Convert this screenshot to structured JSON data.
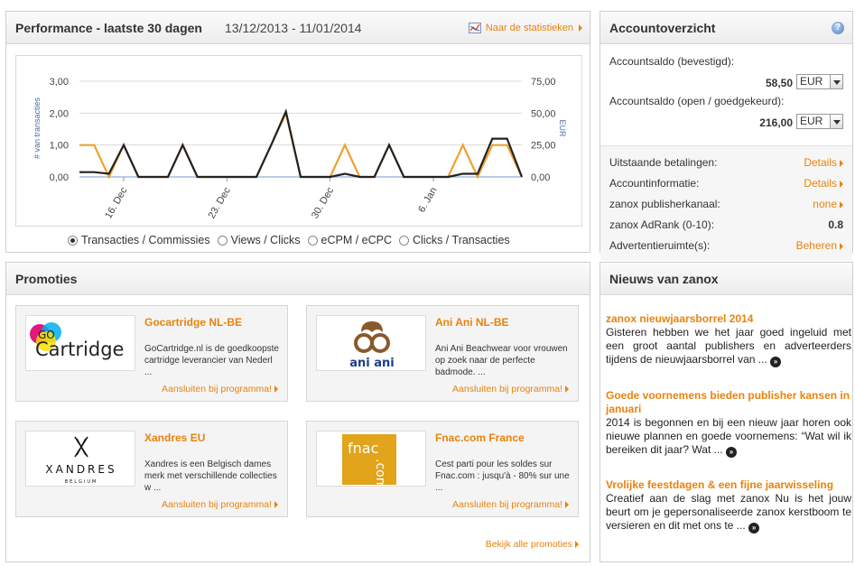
{
  "performance": {
    "title": "Performance - laatste 30 dagen",
    "dates": "13/12/2013 - 11/01/2014",
    "stats_link": "Naar de statistieken",
    "radios": [
      {
        "label": "Transacties / Commissies",
        "checked": true
      },
      {
        "label": "Views / Clicks",
        "checked": false
      },
      {
        "label": "eCPM / eCPC",
        "checked": false
      },
      {
        "label": "Clicks / Transacties",
        "checked": false
      }
    ]
  },
  "chart_data": {
    "type": "line",
    "y_left": {
      "label": "# van transacties",
      "ticks": [
        "3,00",
        "2,00",
        "1,00",
        "0,00"
      ],
      "range": [
        0,
        3
      ]
    },
    "y_right": {
      "label": "EUR",
      "ticks": [
        "75,00",
        "50,00",
        "25,00",
        "0,00"
      ],
      "range": [
        0,
        75
      ]
    },
    "x_ticks": [
      "16. Dec",
      "23. Dec",
      "30. Dec",
      "6. Jan"
    ],
    "x_tick_index": [
      3,
      10,
      17,
      24
    ],
    "series": [
      {
        "color": "#222222",
        "values": [
          0.15,
          0.15,
          0.1,
          1.0,
          0,
          0,
          0,
          1.0,
          0,
          0,
          0,
          0,
          0,
          1.0,
          2.05,
          0,
          0,
          0,
          0.1,
          0,
          0,
          1.0,
          0,
          0,
          0,
          0,
          0.1,
          0.1,
          1.2,
          1.2,
          0
        ]
      },
      {
        "color": "#f0a030",
        "values": [
          1.0,
          1.0,
          0,
          1.0,
          0,
          0,
          0,
          1.0,
          0,
          0,
          0,
          0,
          0,
          1.0,
          2.0,
          0,
          0,
          0,
          1.0,
          0,
          0,
          1.0,
          0,
          0,
          0,
          0,
          1.0,
          0,
          1.0,
          1.0,
          0
        ]
      }
    ]
  },
  "account": {
    "title": "Accountoverzicht",
    "balance_confirmed_label": "Accountsaldo (bevestigd):",
    "balance_confirmed_value": "58,50",
    "balance_open_label": "Accountsaldo (open / goedgekeurd):",
    "balance_open_value": "216,00",
    "currency": "EUR",
    "rows": [
      {
        "label": "Uitstaande betalingen:",
        "value": "Details",
        "link": true
      },
      {
        "label": "Accountinformatie:",
        "value": "Details",
        "link": true
      },
      {
        "label": "zanox publisherkanaal:",
        "value": "none",
        "link": true
      },
      {
        "label": "zanox AdRank (0-10):",
        "value": "0.8",
        "link": false
      },
      {
        "label": "Advertentieruimte(s):",
        "value": "Beheren",
        "link": true
      }
    ]
  },
  "promoties": {
    "title": "Promoties",
    "join_label": "Aansluiten bij programma!",
    "view_all": "Bekijk alle promoties",
    "cards": [
      {
        "title": "Gocartridge NL-BE",
        "desc": "GoCartridge.nl is de goedkoopste cartridge leverancier van Nederl ...",
        "logo_text": "Cartridge",
        "logo_top": "GO"
      },
      {
        "title": "Ani Ani NL-BE",
        "desc": "Ani Ani Beachwear voor vrouwen op zoek naar de perfecte badmode. ...",
        "logo_text": "ani ani"
      },
      {
        "title": "Xandres EU",
        "desc": "Xandres is een Belgisch dames merk met verschillende collecties w ...",
        "logo_text": "XANDRES",
        "logo_sub": "BELGIUM"
      },
      {
        "title": "Fnac.com France",
        "desc": "Cest parti pour les soldes sur Fnac.com : jusqu'à - 80% sur une ...",
        "logo_text": "fnac",
        "logo_sub": ".com"
      }
    ]
  },
  "news": {
    "title": "Nieuws van zanox",
    "items": [
      {
        "title": "zanox nieuwjaarsborrel 2014",
        "text": "Gisteren hebben we het jaar goed ingeluid met een groot aantal publishers en adverteerders tijdens de nieuwjaarsborrel van ..."
      },
      {
        "title": "Goede voornemens bieden publisher kansen in januari",
        "text": "2014 is begonnen en bij een nieuw jaar horen ook nieuwe plannen en goede voornemens: “Wat wil ik bereiken dit jaar? Wat ..."
      },
      {
        "title": "Vrolijke feestdagen & een fijne jaarwisseling",
        "text": "Creatief aan de slag met zanox Nu is het jouw beurt om je gepersonaliseerde zanox kerstboom te versieren en dit met ons te ..."
      }
    ]
  },
  "colors": {
    "accent": "#e8830c",
    "series_dark": "#222222",
    "series_orange": "#f0a030"
  }
}
